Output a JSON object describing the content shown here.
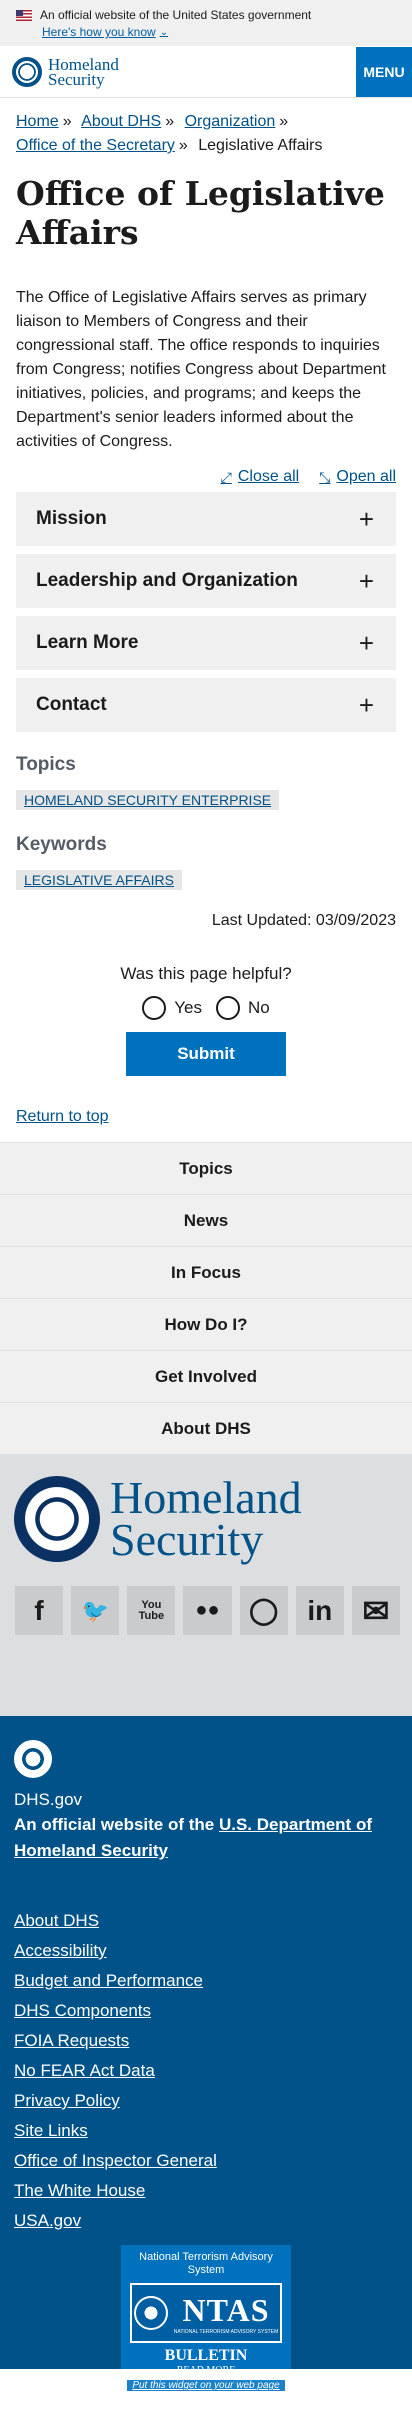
{
  "gov_banner": {
    "text": "An official website of the United States government",
    "toggle_label": "Here's how you know"
  },
  "header": {
    "logo_line1": "Homeland",
    "logo_line2": "Security",
    "menu_label": "MENU"
  },
  "breadcrumb": {
    "items": [
      "Home",
      "About DHS",
      "Organization",
      "Office of the Secretary"
    ],
    "current": "Legislative Affairs"
  },
  "page": {
    "title": "Office of Legislative Affairs",
    "intro": "The Office of Legislative Affairs serves as primary liaison to Members of Congress and their congressional staff. The office responds to inquiries from Congress; notifies Congress about Department initiatives, policies, and programs; and keeps the Department's senior leaders informed about the activities of Congress."
  },
  "accordion": {
    "close_all": "Close all",
    "open_all": "Open all",
    "items": [
      "Mission",
      "Leadership and Organization",
      "Learn More",
      "Contact"
    ]
  },
  "topics": {
    "label": "Topics",
    "tags": [
      "HOMELAND SECURITY ENTERPRISE"
    ]
  },
  "keywords": {
    "label": "Keywords",
    "tags": [
      "LEGISLATIVE AFFAIRS"
    ]
  },
  "last_updated": "Last Updated: 03/09/2023",
  "feedback": {
    "question": "Was this page helpful?",
    "yes": "Yes",
    "no": "No",
    "submit": "Submit"
  },
  "return_top": "Return to top",
  "footer_nav": [
    "Topics",
    "News",
    "In Focus",
    "How Do I?",
    "Get Involved",
    "About DHS"
  ],
  "footer_logo": {
    "line1": "Homeland",
    "line2": "Security"
  },
  "social": [
    "f",
    "t",
    "You Tube",
    "flickr",
    "ig",
    "in",
    "mail"
  ],
  "footer": {
    "site": "DHS.gov",
    "official_prefix": "An official website of the ",
    "official_link": "U.S. Department of Homeland Security",
    "links": [
      "About DHS",
      "Accessibility",
      "Budget and Performance",
      "DHS Components",
      "FOIA Requests",
      "No FEAR Act Data",
      "Privacy Policy",
      "Site Links",
      "Office of Inspector General",
      "The White House",
      "USA.gov"
    ]
  },
  "ntas": {
    "heading": "National Terrorism Advisory System",
    "acronym": "NTAS",
    "sub": "NATIONAL TERRORISM ADVISORY SYSTEM",
    "bulletin": "BULLETIN",
    "read_more": "READ MORE",
    "widget": "Put this widget on your web page"
  }
}
